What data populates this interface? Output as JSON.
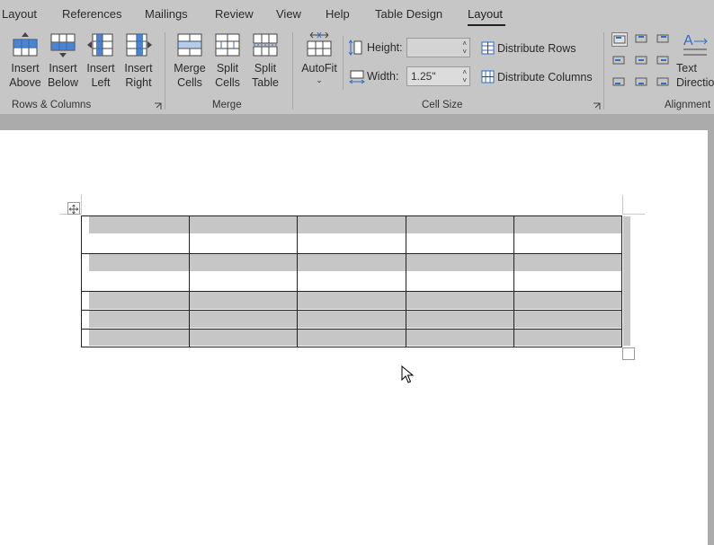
{
  "tabs": [
    {
      "label": "Layout",
      "active": false
    },
    {
      "label": "References",
      "active": false
    },
    {
      "label": "Mailings",
      "active": false
    },
    {
      "label": "Review",
      "active": false
    },
    {
      "label": "View",
      "active": false
    },
    {
      "label": "Help",
      "active": false
    },
    {
      "label": "Table Design",
      "active": false
    },
    {
      "label": "Layout",
      "active": true
    }
  ],
  "rows_columns": {
    "insert_above": "Insert\nAbove",
    "insert_below": "Insert\nBelow",
    "insert_left": "Insert\nLeft",
    "insert_right": "Insert\nRight",
    "group_label": "Rows & Columns"
  },
  "merge": {
    "merge_cells": "Merge\nCells",
    "split_cells": "Split\nCells",
    "split_table": "Split\nTable",
    "group_label": "Merge"
  },
  "cell_size": {
    "autofit": "AutoFit",
    "height_label": "Height:",
    "height_value": "",
    "width_label": "Width:",
    "width_value": "1.25\"",
    "distribute_rows": "Distribute Rows",
    "distribute_columns": "Distribute Columns",
    "group_label": "Cell Size"
  },
  "alignment": {
    "text_direction": "Text\nDirection",
    "group_label": "Alignment"
  },
  "colors": {
    "ribbon": "#c6c6c6",
    "accent_blue": "#2f6fc4",
    "page": "#ffffff",
    "cell_shading": "#c6c6c6"
  }
}
